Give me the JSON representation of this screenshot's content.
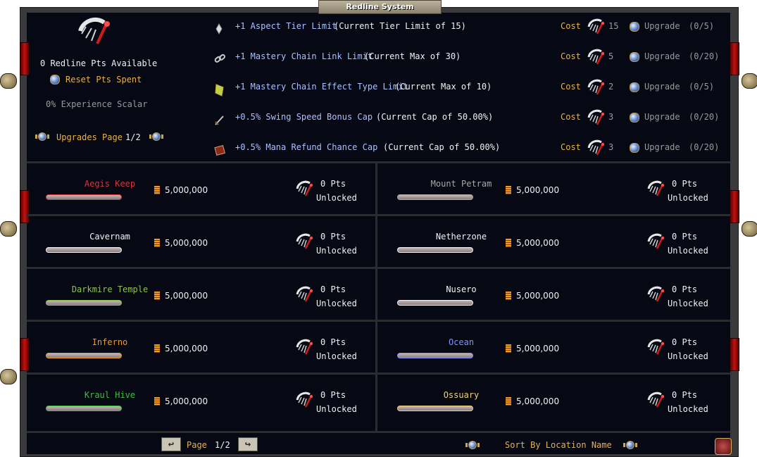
{
  "window": {
    "title": "Redline System"
  },
  "header": {
    "points_available": "0 Redline Pts Available",
    "reset_label": "Reset Pts Spent",
    "experience_scalar": "0% Experience Scalar",
    "upgrades_page_label": "Upgrades Page",
    "upgrades_page_value": "1/2"
  },
  "upgrades": [
    {
      "icon": "aspect-crystal-icon",
      "title": "+1 Aspect Tier Limit",
      "detail": "(Current Tier Limit of 15)",
      "cost_label": "Cost",
      "cost": "15",
      "button": "Upgrade",
      "progress": "(0/5)"
    },
    {
      "icon": "chain-link-icon",
      "title": "+1 Mastery Chain Link Limit",
      "detail": "(Current Max of 30)",
      "cost_label": "Cost",
      "cost": "5",
      "button": "Upgrade",
      "progress": "(0/20)"
    },
    {
      "icon": "scroll-map-icon",
      "title": "+1 Mastery Chain Effect Type Limit",
      "detail": "(Current Max of 10)",
      "cost_label": "Cost",
      "cost": "2",
      "button": "Upgrade",
      "progress": "(0/5)"
    },
    {
      "icon": "sword-icon",
      "title": "+0.5% Swing Speed Bonus Cap",
      "detail": "(Current Cap of 50.00%)",
      "cost_label": "Cost",
      "cost": "3",
      "button": "Upgrade",
      "progress": "(0/20)"
    },
    {
      "icon": "mana-book-icon",
      "title": "+0.5% Mana Refund Chance Cap",
      "detail": "(Current Cap of 50.00%)",
      "cost_label": "Cost",
      "cost": "3",
      "button": "Upgrade",
      "progress": "(0/20)"
    }
  ],
  "locations": [
    {
      "name": "Aegis Keep",
      "color": "#d23a3a",
      "gold": "5,000,000",
      "pts": "0 Pts",
      "status": "Unlocked"
    },
    {
      "name": "Mount Petram",
      "color": "#a8a8a8",
      "gold": "5,000,000",
      "pts": "0 Pts",
      "status": "Unlocked"
    },
    {
      "name": "Cavernam",
      "color": "#f2f2f2",
      "gold": "5,000,000",
      "pts": "0 Pts",
      "status": "Unlocked"
    },
    {
      "name": "Netherzone",
      "color": "#f2f2f2",
      "gold": "5,000,000",
      "pts": "0 Pts",
      "status": "Unlocked"
    },
    {
      "name": "Darkmire Temple",
      "color": "#8fc24a",
      "gold": "5,000,000",
      "pts": "0 Pts",
      "status": "Unlocked"
    },
    {
      "name": "Nusero",
      "color": "#f2f2f2",
      "gold": "5,000,000",
      "pts": "0 Pts",
      "status": "Unlocked"
    },
    {
      "name": "Inferno",
      "color": "#f39b1a",
      "gold": "5,000,000",
      "pts": "0 Pts",
      "status": "Unlocked"
    },
    {
      "name": "Ocean",
      "color": "#7e95ff",
      "gold": "5,000,000",
      "pts": "0 Pts",
      "status": "Unlocked"
    },
    {
      "name": "Kraul Hive",
      "color": "#3fbf3f",
      "gold": "5,000,000",
      "pts": "0 Pts",
      "status": "Unlocked"
    },
    {
      "name": "Ossuary",
      "color": "#f0d27a",
      "gold": "5,000,000",
      "pts": "0 Pts",
      "status": "Unlocked"
    }
  ],
  "footer": {
    "page_label": "Page",
    "page_value": "1/2",
    "sort_label": "Sort By Location Name"
  },
  "colors": {
    "accent_gold": "#e8b24a",
    "upgrade_text": "#a9c1ff",
    "background": "#060814"
  }
}
